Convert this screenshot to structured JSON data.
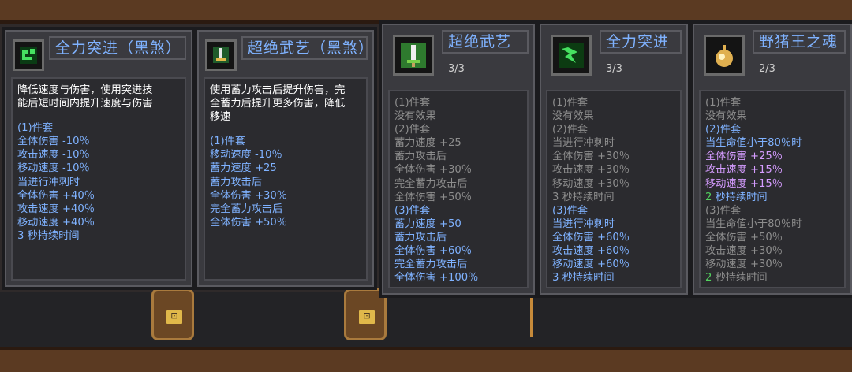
{
  "colors": {
    "blue": "#7fb2ff",
    "gray": "#8d8d8d",
    "white": "#ffffff",
    "purple": "#d59cff",
    "green": "#52d25e"
  },
  "cards": [
    {
      "title": "全力突进（黑煞）",
      "icon": "green-rune-icon",
      "desc": [
        "降低速度与伤害，使用突进技",
        "能后短时间内提升速度与伤害"
      ],
      "lines": [
        {
          "t": "(1)件套",
          "c": "blue"
        },
        {
          "t": "全体伤害 -10％",
          "c": "blue"
        },
        {
          "t": "攻击速度 -10％",
          "c": "blue"
        },
        {
          "t": "移动速度 -10％",
          "c": "blue"
        },
        {
          "t": "当进行冲刺时",
          "c": "blue"
        },
        {
          "t": "全体伤害 +40％",
          "c": "blue"
        },
        {
          "t": "攻击速度 +40％",
          "c": "blue"
        },
        {
          "t": "移动速度 +40％",
          "c": "blue"
        },
        {
          "t": "3 秒持续时间",
          "c": "blue"
        }
      ]
    },
    {
      "title": "超绝武艺（黑煞）",
      "icon": "sword-emblem-icon",
      "desc": [
        "使用蓄力攻击后提升伤害，完",
        "全蓄力后提升更多伤害，降低",
        "移速"
      ],
      "lines": [
        {
          "t": "(1)件套",
          "c": "blue"
        },
        {
          "t": "移动速度 -10％",
          "c": "blue"
        },
        {
          "t": "蓄力速度 +25",
          "c": "blue"
        },
        {
          "t": "蓄力攻击后",
          "c": "blue"
        },
        {
          "t": "全体伤害 +30％",
          "c": "blue"
        },
        {
          "t": "完全蓄力攻击后",
          "c": "blue"
        },
        {
          "t": "全体伤害 +50％",
          "c": "blue"
        }
      ]
    },
    {
      "title": "超绝武艺",
      "icon": "sword-icon",
      "count": "3/3",
      "lines": [
        {
          "t": "(1)件套",
          "c": "gray"
        },
        {
          "t": "没有效果",
          "c": "gray"
        },
        {
          "t": "(2)件套",
          "c": "gray"
        },
        {
          "t": "蓄力速度 +25",
          "c": "gray"
        },
        {
          "t": "蓄力攻击后",
          "c": "gray"
        },
        {
          "t": "全体伤害 +30％",
          "c": "gray"
        },
        {
          "t": "完全蓄力攻击后",
          "c": "gray"
        },
        {
          "t": "全体伤害 +50％",
          "c": "gray"
        },
        {
          "t": "(3)件套",
          "c": "blue"
        },
        {
          "t": "蓄力速度 +50",
          "c": "blue"
        },
        {
          "t": "蓄力攻击后",
          "c": "blue"
        },
        {
          "t": "全体伤害 +60％",
          "c": "blue"
        },
        {
          "t": "完全蓄力攻击后",
          "c": "blue"
        },
        {
          "t": "全体伤害 +100％",
          "c": "blue"
        }
      ]
    },
    {
      "title": "全力突进",
      "icon": "green-dash-icon",
      "count": "3/3",
      "lines": [
        {
          "t": "(1)件套",
          "c": "gray"
        },
        {
          "t": "没有效果",
          "c": "gray"
        },
        {
          "t": "(2)件套",
          "c": "gray"
        },
        {
          "t": "当进行冲刺时",
          "c": "gray"
        },
        {
          "t": "全体伤害 +30％",
          "c": "gray"
        },
        {
          "t": "攻击速度 +30％",
          "c": "gray"
        },
        {
          "t": "移动速度 +30％",
          "c": "gray"
        },
        {
          "t": "3 秒持续时间",
          "c": "gray"
        },
        {
          "t": "(3)件套",
          "c": "blue"
        },
        {
          "t": "当进行冲刺时",
          "c": "blue"
        },
        {
          "t": "全体伤害 +60％",
          "c": "blue"
        },
        {
          "t": "攻击速度 +60％",
          "c": "blue"
        },
        {
          "t": "移动速度 +60％",
          "c": "blue"
        },
        {
          "t": "3 秒持续时间",
          "c": "blue"
        }
      ]
    },
    {
      "title": "野猪王之魂",
      "icon": "boar-soul-icon",
      "count": "2/3",
      "lines": [
        {
          "t": "(1)件套",
          "c": "gray"
        },
        {
          "t": "没有效果",
          "c": "gray"
        },
        {
          "t": "(2)件套",
          "c": "blue"
        },
        {
          "t": "当生命值小于80％时",
          "c": "blue"
        },
        {
          "t": "全体伤害 +25％",
          "c": "purple"
        },
        {
          "t": "攻击速度 +15％",
          "c": "purple"
        },
        {
          "t": "移动速度 +15％",
          "c": "purple"
        },
        {
          "p": "2",
          "s": " 秒持续时间",
          "c": "blue"
        },
        {
          "t": "(3)件套",
          "c": "gray"
        },
        {
          "t": "当生命值小于80％时",
          "c": "gray"
        },
        {
          "t": "全体伤害 +50％",
          "c": "gray"
        },
        {
          "t": "攻击速度 +30％",
          "c": "gray"
        },
        {
          "t": "移动速度 +30％",
          "c": "gray"
        },
        {
          "p": "2",
          "s": " 秒持续时间",
          "c": "gray"
        }
      ]
    }
  ]
}
